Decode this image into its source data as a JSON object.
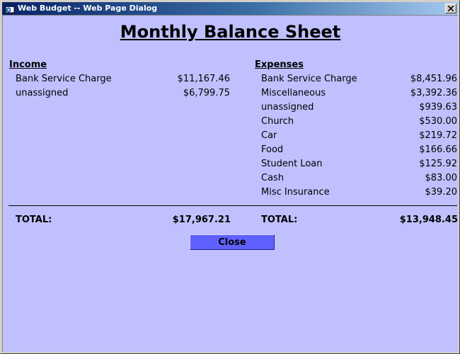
{
  "window": {
    "title": "Web Budget -- Web Page Dialog"
  },
  "page": {
    "title": "Monthly Balance Sheet"
  },
  "income": {
    "heading": "Income",
    "rows": [
      {
        "label": "Bank Service Charge",
        "amount": "$11,167.46"
      },
      {
        "label": "unassigned",
        "amount": "$6,799.75"
      }
    ],
    "total_label": "TOTAL:",
    "total_value": "$17,967.21"
  },
  "expenses": {
    "heading": "Expenses",
    "rows": [
      {
        "label": "Bank Service Charge",
        "amount": "$8,451.96"
      },
      {
        "label": "Miscellaneous",
        "amount": "$3,392.36"
      },
      {
        "label": "unassigned",
        "amount": "$939.63"
      },
      {
        "label": "Church",
        "amount": "$530.00"
      },
      {
        "label": "Car",
        "amount": "$219.72"
      },
      {
        "label": "Food",
        "amount": "$166.66"
      },
      {
        "label": "Student Loan",
        "amount": "$125.92"
      },
      {
        "label": "Cash",
        "amount": "$83.00"
      },
      {
        "label": "Misc Insurance",
        "amount": "$39.20"
      }
    ],
    "total_label": "TOTAL:",
    "total_value": "$13,948.45"
  },
  "actions": {
    "close_label": "Close"
  },
  "icons": {
    "app": "web-page-dialog-icon",
    "window_close": "close-x-icon"
  },
  "colors": {
    "content_background": "#c0c0ff",
    "button_background": "#6060ff",
    "titlebar_start": "#0a246a",
    "titlebar_end": "#a6caf0"
  }
}
